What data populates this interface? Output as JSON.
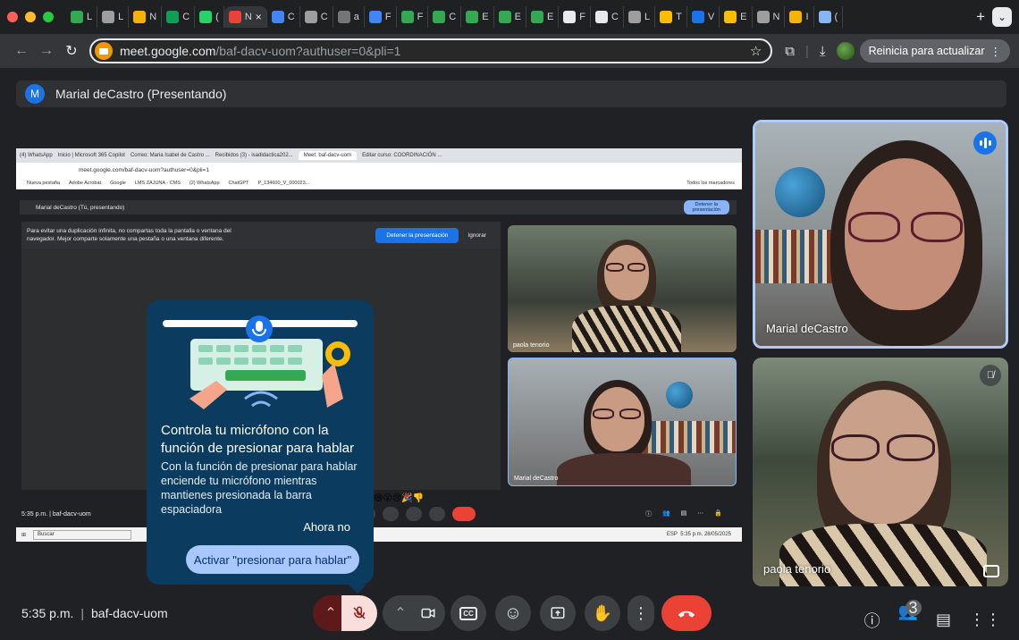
{
  "browser": {
    "tabs": [
      {
        "letter": "L",
        "color": "#34a853"
      },
      {
        "letter": "L",
        "color": "#9e9e9e"
      },
      {
        "letter": "N",
        "color": "#f4b400"
      },
      {
        "letter": "C",
        "color": "#0f9d58"
      },
      {
        "letter": "(",
        "color": "#25d366"
      },
      {
        "letter": "N",
        "color": "#ea4335",
        "active": true
      },
      {
        "letter": "C",
        "color": "#4285f4"
      },
      {
        "letter": "C",
        "color": "#9e9e9e"
      },
      {
        "letter": "a",
        "color": "#757575"
      },
      {
        "letter": "F",
        "color": "#4285f4"
      },
      {
        "letter": "F",
        "color": "#34a853"
      },
      {
        "letter": "C",
        "color": "#34a853"
      },
      {
        "letter": "E",
        "color": "#34a853"
      },
      {
        "letter": "E",
        "color": "#34a853"
      },
      {
        "letter": "E",
        "color": "#34a853"
      },
      {
        "letter": "F",
        "color": "#e8eaed"
      },
      {
        "letter": "C",
        "color": "#e8eaed"
      },
      {
        "letter": "L",
        "color": "#9e9e9e"
      },
      {
        "letter": "T",
        "color": "#fbbc04"
      },
      {
        "letter": "V",
        "color": "#1a73e8"
      },
      {
        "letter": "E",
        "color": "#fbbc04"
      },
      {
        "letter": "N",
        "color": "#9e9e9e"
      },
      {
        "letter": "I",
        "color": "#f4b400"
      },
      {
        "letter": "(",
        "color": "#8ab4f8"
      }
    ],
    "active_close": "×",
    "new_tab": "+",
    "profile_menu": "⌄",
    "url_host": "meet.google.com",
    "url_path": "/baf-dacv-uom?authuser=0&pli=1",
    "update_label": "Reinicia para actualizar",
    "update_more": "⋮"
  },
  "meet": {
    "presenter_initial": "M",
    "presenter_label": "Marial deCastro (Presentando)",
    "shared": {
      "tabs": [
        "(4) WhatsApp",
        "Inicio | Microsoft 365 Copilot",
        "Correo: Maria Isabel de Castro ...",
        "Recibidos (3) - isadidactica202...",
        "Meet: baf-dacv-uom",
        "Editar curso: COORDINACIÓN ..."
      ],
      "url": "meet.google.com/baf-dacv-uom?authuser=0&pli=1",
      "bookmarks": [
        "Nueva pestaña",
        "Adobe Acrobat",
        "Google",
        "LMS ZAJUNA - CMS",
        "(2) WhatsApp",
        "ChatGPT",
        "P_134600_V_000023..."
      ],
      "bookmarks_right": "Todos los marcadores",
      "present_label": "Marial deCastro (Tú, presentando)",
      "stop_label_1": "Detener la",
      "stop_label_2": "presentación",
      "warning_1": "Para evitar una duplicación infinita, no compartas toda la pantalla o ventana del",
      "warning_2": "navegador. Mejor comparte solamente una pestaña o una ventana diferente.",
      "warning_btn": "Detener la presentación",
      "warning_ignore": "Ignorar",
      "tile1_name": "paola tenorio",
      "tile2_name": "Marial deCastro",
      "emoji": "😄😮😢🎉👎",
      "time": "5:35 p.m.",
      "code": "baf-dacv-uom",
      "taskbar_search": "Buscar",
      "taskbar_time": "5:35 p.m.",
      "taskbar_date": "28/05/2025",
      "taskbar_lang": "ESP"
    },
    "participants": {
      "top_name": "Marial deCastro",
      "bottom_name": "paola tenorio"
    },
    "popup": {
      "title": "Controla tu micrófono con la función de presionar para hablar",
      "body": "Con la función de presionar para hablar enciende tu micrófono mientras mantienes presionada la barra espaciadora",
      "dismiss": "Ahora no",
      "cta": "Activar \"presionar para hablar\""
    },
    "footer": {
      "time": "5:35 p.m.",
      "separator": "|",
      "code": "baf-dacv-uom",
      "participants_count": "3"
    }
  }
}
